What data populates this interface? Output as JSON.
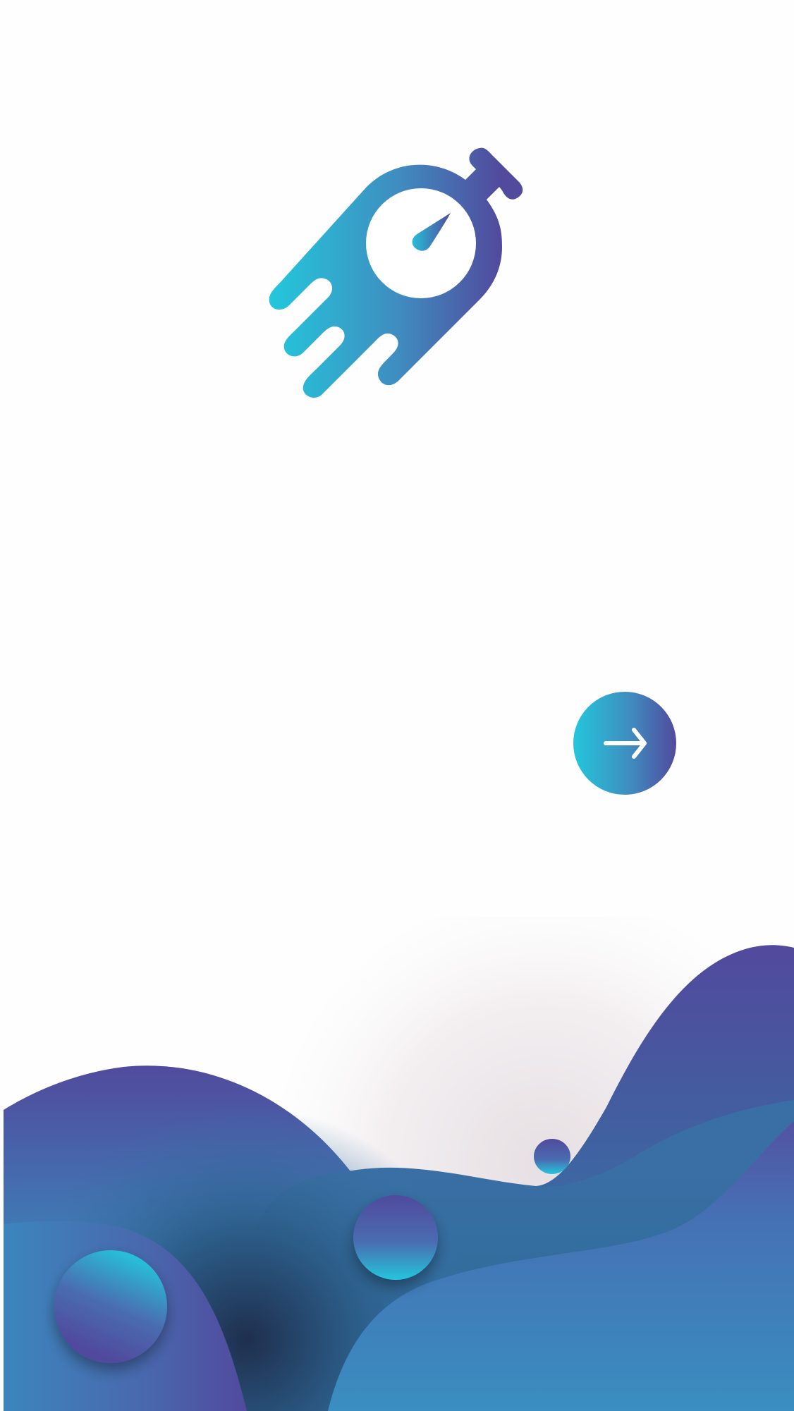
{
  "app": {
    "screen": "splash-onboarding",
    "logo_icon": "speed-rocket-stopwatch-icon"
  },
  "next": {
    "icon": "arrow-right-icon",
    "aria_label": ""
  },
  "colors": {
    "background": "#fefefe",
    "brand_cyan": "#24c6dc",
    "brand_blue": "#3f8dc0",
    "brand_purple": "#514a9d",
    "wave_deep": "#1f3050",
    "icon_foreground": "#ffffff"
  },
  "decorations": [
    {
      "name": "bubble-large",
      "gradient": "cyan-to-purple"
    },
    {
      "name": "bubble-medium",
      "gradient": "purple-to-cyan"
    },
    {
      "name": "bubble-small",
      "gradient": "purple-to-cyan"
    }
  ]
}
